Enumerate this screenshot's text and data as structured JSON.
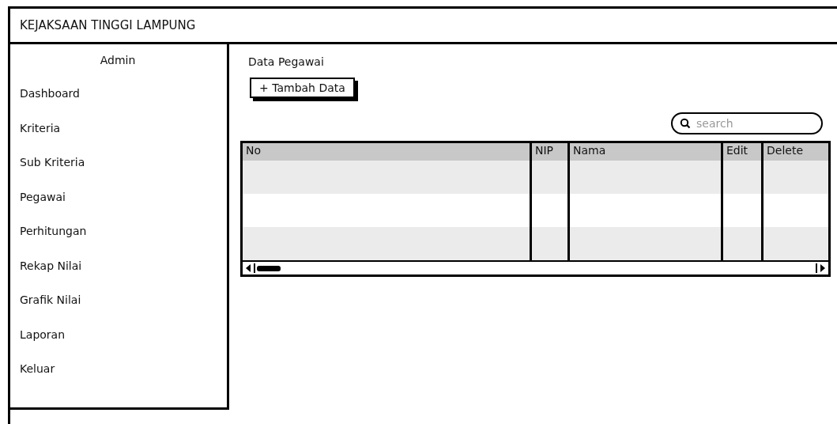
{
  "header": {
    "title": "KEJAKSAAN TINGGI LAMPUNG"
  },
  "sidebar": {
    "title": "Admin",
    "items": [
      {
        "label": "Dashboard"
      },
      {
        "label": "Kriteria"
      },
      {
        "label": "Sub Kriteria"
      },
      {
        "label": "Pegawai"
      },
      {
        "label": "Perhitungan"
      },
      {
        "label": "Rekap Nilai"
      },
      {
        "label": "Grafik Nilai"
      },
      {
        "label": "Laporan"
      },
      {
        "label": "Keluar"
      }
    ]
  },
  "main": {
    "title": "Data Pegawai",
    "add_button": "+ Tambah Data",
    "search": {
      "placeholder": "search"
    },
    "table": {
      "columns": [
        "No",
        "NIP",
        "Nama",
        "Edit",
        "Delete"
      ]
    }
  }
}
